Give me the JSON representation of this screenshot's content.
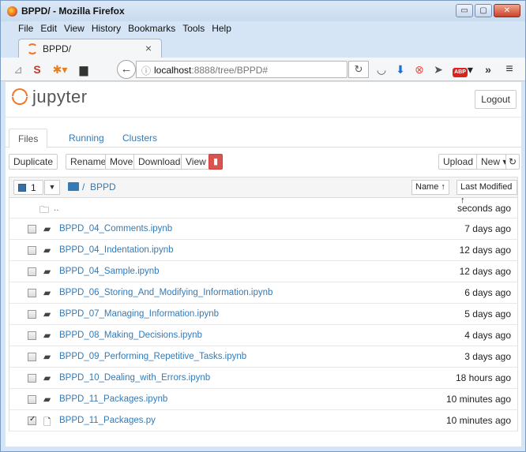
{
  "window": {
    "title": "BPPD/ - Mozilla Firefox",
    "minimize": "▭",
    "maximize": "▢",
    "close": "✕"
  },
  "menu": [
    "File",
    "Edit",
    "View",
    "History",
    "Bookmarks",
    "Tools",
    "Help"
  ],
  "browser_tab": {
    "label": "BPPD/",
    "close": "×"
  },
  "navbar": {
    "url_host": "localhost",
    "url_path": ":8888/tree/BPPD#",
    "icons": [
      "rss-icon",
      "s-addon-icon",
      "bug-icon",
      "printer-icon",
      "pocket-icon",
      "download-icon",
      "blocker-icon",
      "send-icon",
      "adblock-icon",
      "overflow-icon",
      "menu-icon"
    ],
    "adblock_label": "ABP",
    "overflow": "»",
    "menu": "≡"
  },
  "jupyter": {
    "logo_text": "jupyter",
    "logout": "Logout",
    "tabs": [
      "Files",
      "Running",
      "Clusters"
    ],
    "toolbar": {
      "duplicate": "Duplicate",
      "rename": "Rename",
      "move": "Move",
      "download": "Download",
      "view": "View",
      "upload": "Upload",
      "new": "New ▾",
      "refresh": "↻"
    },
    "list_header": {
      "selected_count": "1",
      "path_sep": "/",
      "path": "BPPD",
      "sort_name": "Name ↑",
      "sort_modified": "Last Modified ↑"
    },
    "parent": {
      "name": "..",
      "modified": "seconds ago"
    },
    "files": [
      {
        "name": "BPPD_04_Comments.ipynb",
        "modified": "7 days ago",
        "type": "notebook",
        "checked": false
      },
      {
        "name": "BPPD_04_Indentation.ipynb",
        "modified": "12 days ago",
        "type": "notebook",
        "checked": false
      },
      {
        "name": "BPPD_04_Sample.ipynb",
        "modified": "12 days ago",
        "type": "notebook",
        "checked": false
      },
      {
        "name": "BPPD_06_Storing_And_Modifying_Information.ipynb",
        "modified": "6 days ago",
        "type": "notebook",
        "checked": false
      },
      {
        "name": "BPPD_07_Managing_Information.ipynb",
        "modified": "5 days ago",
        "type": "notebook",
        "checked": false
      },
      {
        "name": "BPPD_08_Making_Decisions.ipynb",
        "modified": "4 days ago",
        "type": "notebook",
        "checked": false
      },
      {
        "name": "BPPD_09_Performing_Repetitive_Tasks.ipynb",
        "modified": "3 days ago",
        "type": "notebook",
        "checked": false
      },
      {
        "name": "BPPD_10_Dealing_with_Errors.ipynb",
        "modified": "18 hours ago",
        "type": "notebook",
        "checked": false
      },
      {
        "name": "BPPD_11_Packages.ipynb",
        "modified": "10 minutes ago",
        "type": "notebook",
        "checked": false
      },
      {
        "name": "BPPD_11_Packages.py",
        "modified": "10 minutes ago",
        "type": "file",
        "checked": true
      }
    ]
  },
  "colors": {
    "link": "#337ab7",
    "jupyter_orange": "#f37726",
    "delete_red": "#d9534f"
  }
}
